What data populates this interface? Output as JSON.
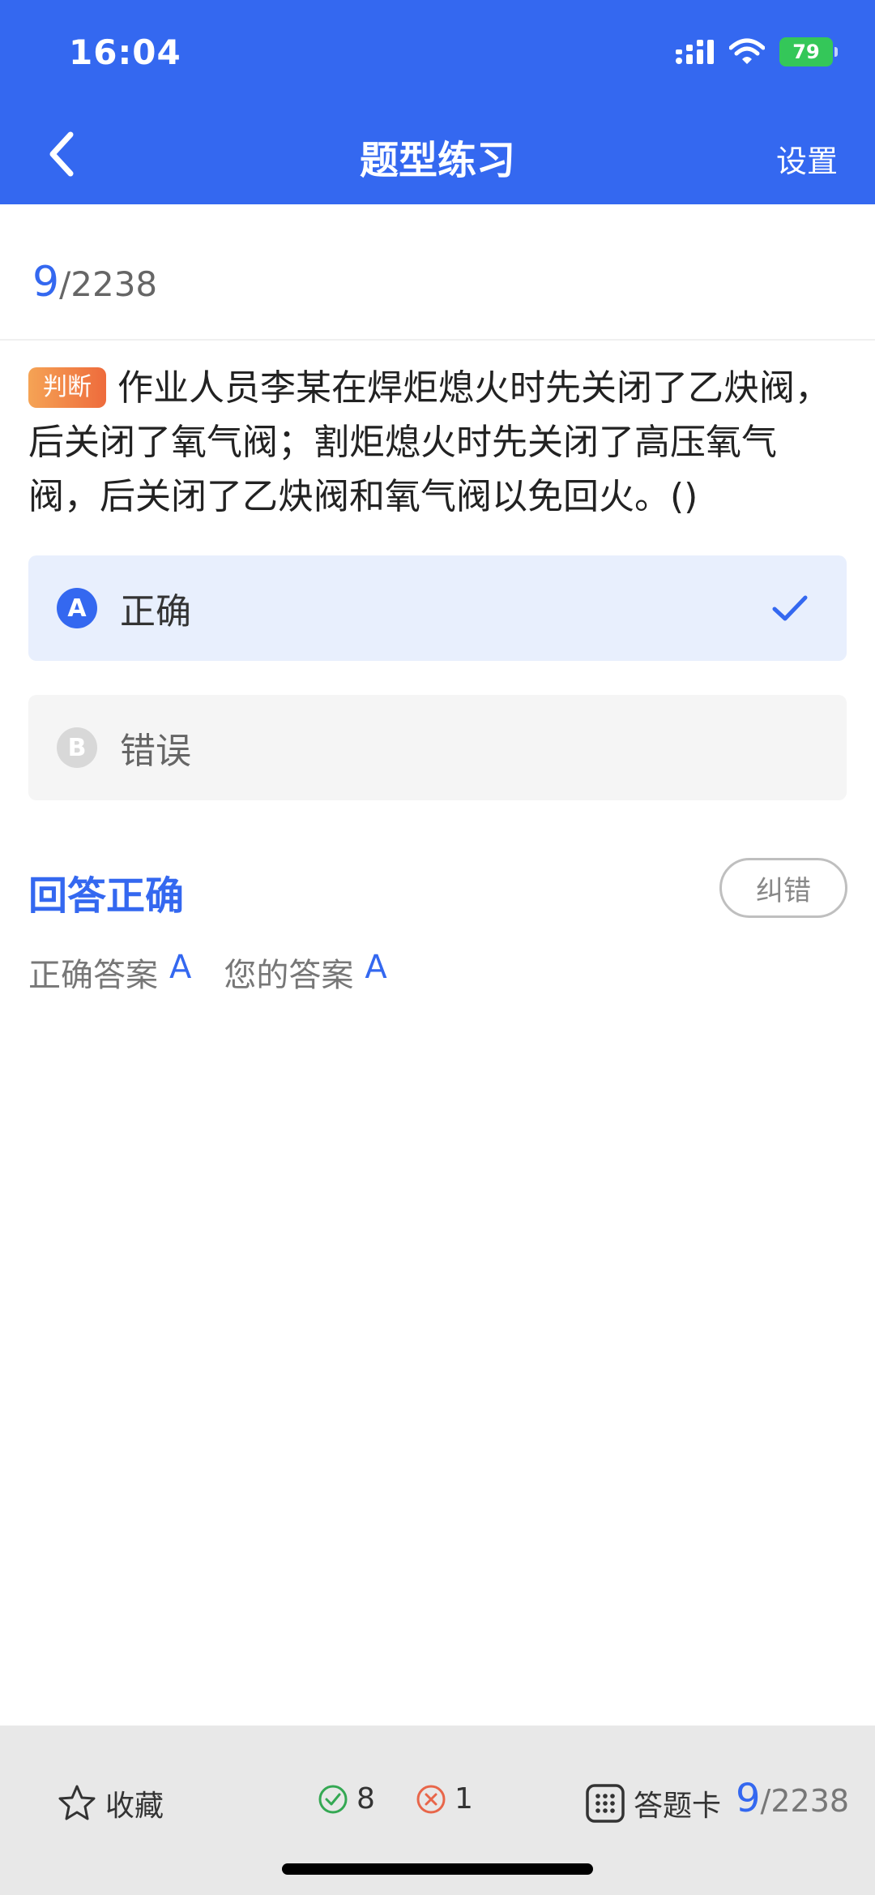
{
  "status": {
    "time": "16:04",
    "battery": "79"
  },
  "header": {
    "title": "题型练习",
    "settings_label": "设置"
  },
  "progress": {
    "current": "9",
    "total": "/2238"
  },
  "question": {
    "type": "判断",
    "text": "作业人员李某在焊炬熄火时先关闭了乙炔阀，后关闭了氧气阀；割炬熄火时先关闭了高压氧气阀，后关闭了乙炔阀和氧气阀以免回火。()"
  },
  "options": [
    {
      "letter": "A",
      "text": "正确",
      "selected": true
    },
    {
      "letter": "B",
      "text": "错误",
      "selected": false
    }
  ],
  "result": {
    "title": "回答正确",
    "report_label": "纠错",
    "correct_answer_label": "正确答案",
    "correct_answer_value": "A",
    "your_answer_label": "您的答案",
    "your_answer_value": "A"
  },
  "bottom_bar": {
    "favorite_label": "收藏",
    "correct_count": "8",
    "wrong_count": "1",
    "card_label": "答题卡",
    "progress_current": "9",
    "progress_total": "/2238"
  },
  "colors": {
    "primary": "#3468F0",
    "selected_bg": "#E8EFFD",
    "correct": "#34A853",
    "wrong": "#E8664A"
  }
}
